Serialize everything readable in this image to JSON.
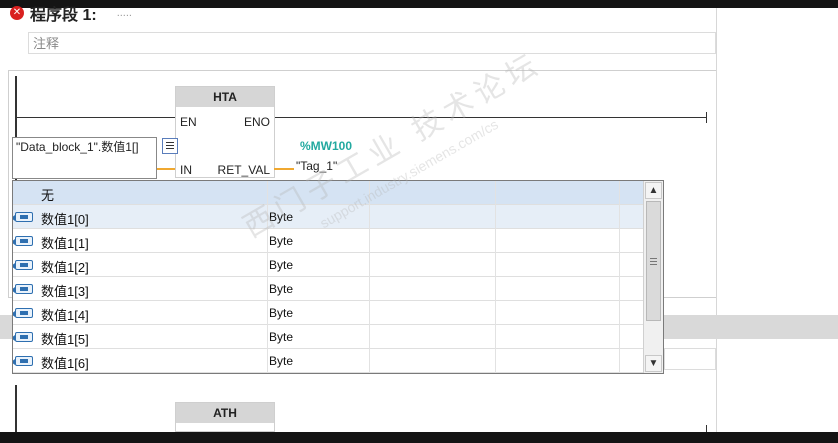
{
  "segment": {
    "title": "程序段 1:",
    "title_suffix": "....."
  },
  "comment": {
    "placeholder": "注释"
  },
  "block1": {
    "name": "HTA",
    "pins": {
      "en": "EN",
      "eno": "ENO",
      "in": "IN",
      "ret": "RET_VAL"
    }
  },
  "block2": {
    "name": "ATH"
  },
  "output": {
    "address": "%MW100",
    "tag": "\"Tag_1\""
  },
  "input_edit": {
    "text": "\"Data_block_1\".数值1[]"
  },
  "dropdown": {
    "header": "无",
    "rows": [
      {
        "name": "数值1[0]",
        "type": "Byte"
      },
      {
        "name": "数值1[1]",
        "type": "Byte"
      },
      {
        "name": "数值1[2]",
        "type": "Byte"
      },
      {
        "name": "数值1[3]",
        "type": "Byte"
      },
      {
        "name": "数值1[4]",
        "type": "Byte"
      },
      {
        "name": "数值1[5]",
        "type": "Byte"
      },
      {
        "name": "数值1[6]",
        "type": "Byte"
      }
    ]
  },
  "watermark": {
    "line1": "西门子工业 技术论坛",
    "line2": "support.industry.siemens.com/cs"
  },
  "colors": {
    "accent_address": "#22a9a0",
    "connector": "#f0a830",
    "header_row": "#d5e3f3"
  },
  "icons": {
    "error": "error-icon",
    "tag_item": "tag-item-icon",
    "scroll_up": "scroll-up-icon",
    "scroll_down": "scroll-down-icon",
    "list_button": "list-icon"
  }
}
